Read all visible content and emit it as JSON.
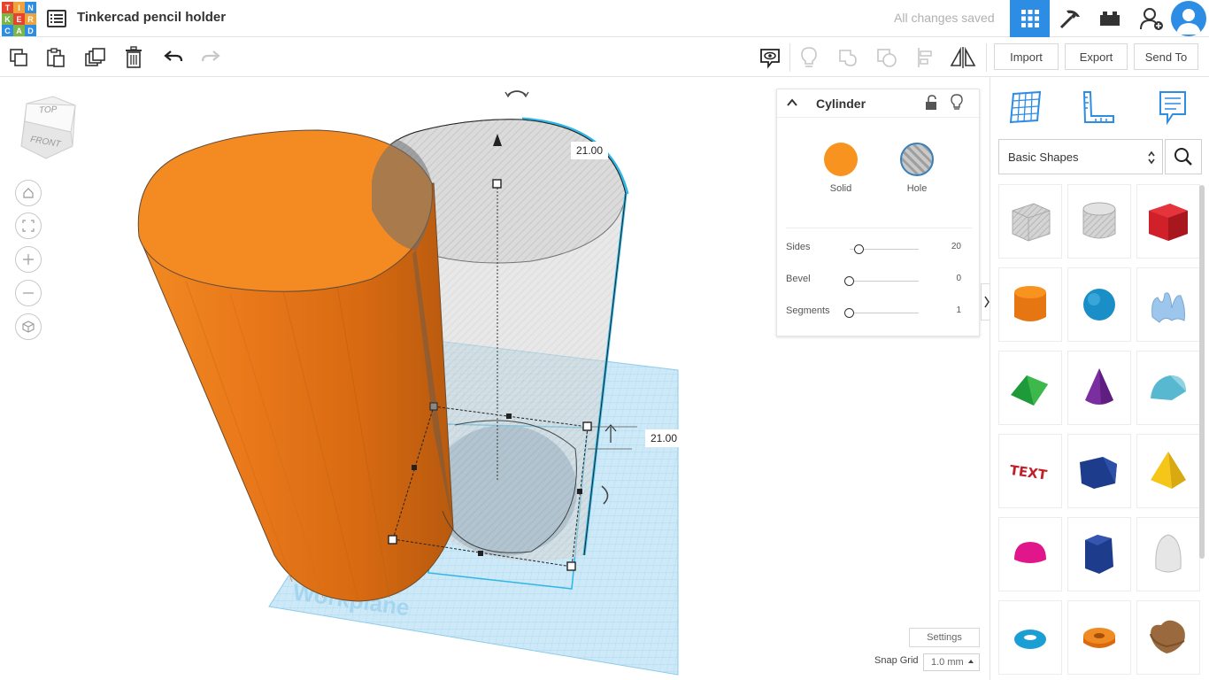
{
  "app": {
    "logo_letters": [
      "T",
      "I",
      "N",
      "K",
      "E",
      "R",
      "C",
      "A",
      "D"
    ],
    "logo_colors": [
      "#e8412c",
      "#f0a23b",
      "#2d8ce3",
      "#7ab648",
      "#e8412c",
      "#f0a23b",
      "#2d8ce3",
      "#7ab648",
      "#2d8ce3"
    ],
    "project_title": "Tinkercad pencil holder",
    "save_status": "All changes saved",
    "accent_color": "#2d8ce3"
  },
  "top_nav": {
    "items": [
      {
        "name": "3d-design-view-icon",
        "active": true
      },
      {
        "name": "pickaxe-icon",
        "active": false
      },
      {
        "name": "bricks-icon",
        "active": false
      },
      {
        "name": "add-user-icon",
        "active": false
      }
    ]
  },
  "toolbar": {
    "import_label": "Import",
    "export_label": "Export",
    "send_to_label": "Send To"
  },
  "viewport": {
    "viewcube": {
      "top_label": "TOP",
      "front_label": "FRONT"
    },
    "workplane_label": "Workplane",
    "dimension_top": "21.00",
    "dimension_side": "21.00",
    "settings_label": "Settings",
    "snap_grid_label": "Snap Grid",
    "snap_grid_value": "1.0 mm"
  },
  "inspector": {
    "title": "Cylinder",
    "solid_label": "Solid",
    "hole_label": "Hole",
    "solid_color": "#f7931e",
    "properties": [
      {
        "label": "Sides",
        "value": "20",
        "fraction": 0.14
      },
      {
        "label": "Bevel",
        "value": "0",
        "fraction": 0.0
      },
      {
        "label": "Segments",
        "value": "1",
        "fraction": 0.0
      }
    ]
  },
  "shapes_panel": {
    "library": "Basic Shapes",
    "shapes": [
      "box-hole",
      "cylinder-hole",
      "box",
      "cylinder",
      "sphere",
      "scribble",
      "roof",
      "cone",
      "round-roof",
      "text",
      "prism",
      "pyramid",
      "half-sphere",
      "polygon",
      "paraboloid",
      "torus",
      "tube",
      "heart"
    ]
  }
}
